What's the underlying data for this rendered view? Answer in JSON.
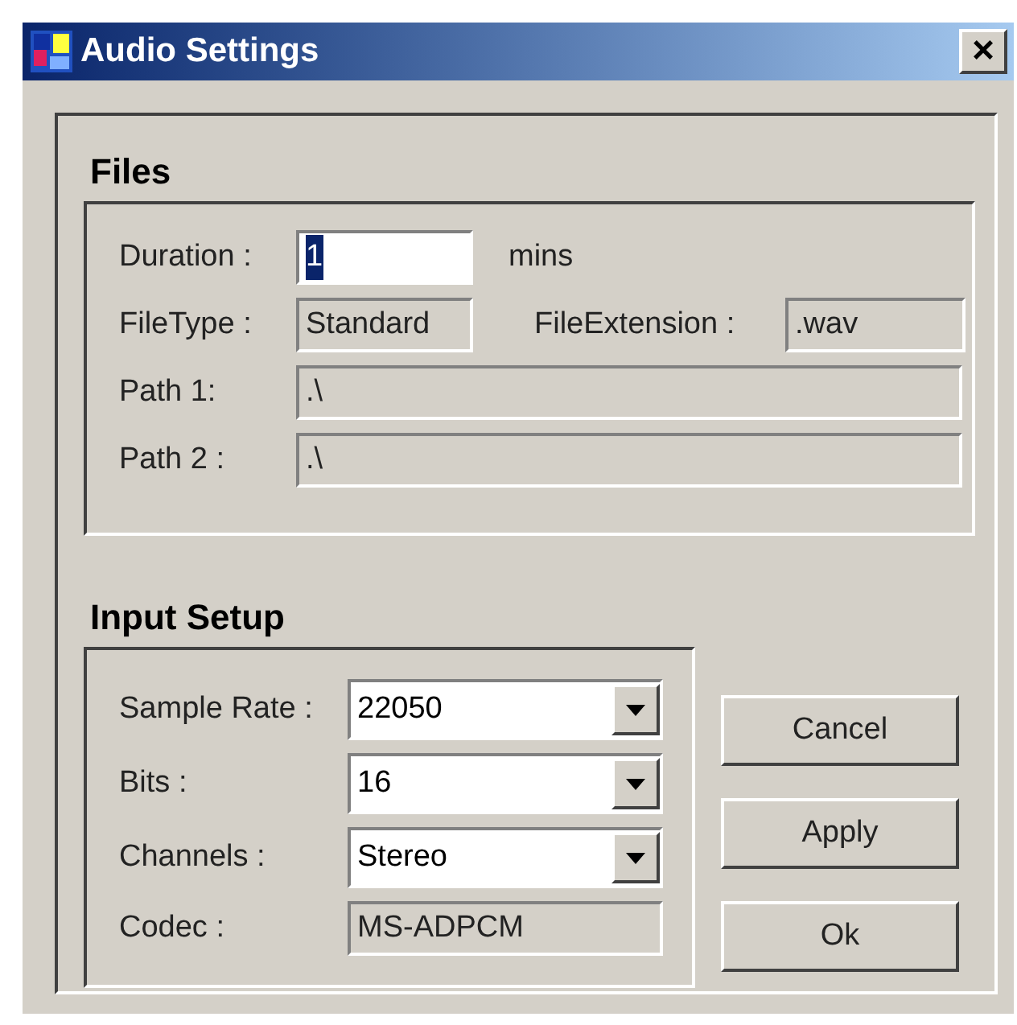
{
  "window": {
    "title": "Audio Settings",
    "close": "×"
  },
  "files": {
    "heading": "Files",
    "duration": {
      "label": "Duration :",
      "value": "1",
      "text_selected": true,
      "unit": "mins"
    },
    "file_type": {
      "label": "FileType :",
      "value": "Standard",
      "disabled": true
    },
    "file_extension": {
      "label": "FileExtension :",
      "value": ".wav",
      "disabled": true
    },
    "paths": [
      {
        "label": "Path 1:",
        "value": ".\\",
        "disabled": true
      },
      {
        "label": "Path 2 :",
        "value": ".\\",
        "disabled": true
      }
    ]
  },
  "input_setup": {
    "heading": "Input Setup",
    "rows": [
      {
        "kind": "dropdown",
        "label": "Sample Rate :",
        "value": "22050"
      },
      {
        "kind": "dropdown",
        "label": "Bits :",
        "value": "16"
      },
      {
        "kind": "dropdown",
        "label": "Channels :",
        "value": "Stereo"
      },
      {
        "kind": "readonly",
        "label": "Codec :",
        "value": "MS-ADPCM"
      }
    ]
  },
  "buttons": [
    "Cancel",
    "Apply",
    "Ok"
  ]
}
